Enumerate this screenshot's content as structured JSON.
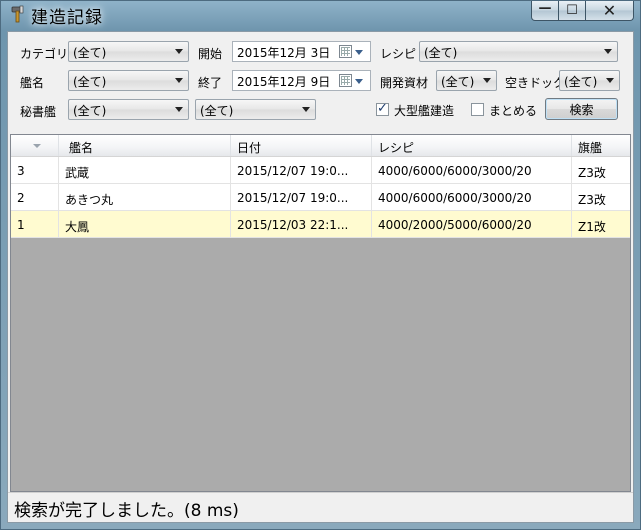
{
  "window": {
    "title": "建造記録",
    "minimize_glyph": "—",
    "maximize_glyph": "☐",
    "close_glyph": "✕"
  },
  "filters": {
    "category": {
      "label": "カテゴリ",
      "value": "(全て)"
    },
    "start": {
      "label": "開始",
      "value": "2015年12月  3日"
    },
    "recipe": {
      "label": "レシピ",
      "value": "(全て)"
    },
    "ship_name": {
      "label": "艦名",
      "value": "(全て)"
    },
    "end": {
      "label": "終了",
      "value": "2015年12月  9日"
    },
    "dev_material": {
      "label": "開発資材",
      "value": "(全て)"
    },
    "empty_dock": {
      "label": "空きドック",
      "value": "(全て)"
    },
    "secretary": {
      "label": "秘書艦",
      "value": "(全て)",
      "value2": "(全て)"
    },
    "large_construction": {
      "label": "大型艦建造",
      "checked": true
    },
    "summarize": {
      "label": "まとめる",
      "checked": false
    },
    "search_button": "検索"
  },
  "grid": {
    "columns": [
      "",
      "艦名",
      "日付",
      "レシピ",
      "旗艦"
    ],
    "rows": [
      {
        "id": "3",
        "name": "武蔵",
        "date": "2015/12/07 19:0...",
        "recipe": "4000/6000/6000/3000/20",
        "flagship": "Z3改",
        "selected": false
      },
      {
        "id": "2",
        "name": "あきつ丸",
        "date": "2015/12/07 19:0...",
        "recipe": "4000/6000/6000/3000/20",
        "flagship": "Z3改",
        "selected": false
      },
      {
        "id": "1",
        "name": "大鳳",
        "date": "2015/12/03 22:1...",
        "recipe": "4000/2000/5000/6000/20",
        "flagship": "Z1改",
        "selected": true
      }
    ]
  },
  "status": {
    "text": "検索が完了しました。(8 ms)"
  },
  "colors": {
    "selected_row": "#fffbd0",
    "grid_empty": "#ababab",
    "accent": "#1d3c6e"
  }
}
